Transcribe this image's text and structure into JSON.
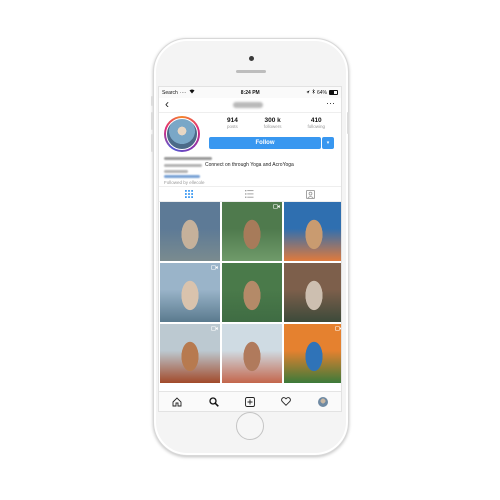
{
  "status_bar": {
    "carrier": "Search",
    "signal": "····",
    "time": "8:24 PM",
    "battery": "64%"
  },
  "nav": {
    "back_glyph": "‹",
    "more_glyph": "···"
  },
  "profile": {
    "stats": [
      {
        "num": "914",
        "label": "posts"
      },
      {
        "num": "300 k",
        "label": "followers"
      },
      {
        "num": "410",
        "label": "following"
      }
    ],
    "follow_label": "Follow",
    "dropdown_glyph": "▾",
    "bio_text": "Connect on through Yoga and AcroYoga",
    "followed_by": "Followed by ellecole"
  },
  "grid": {
    "cells": [
      {
        "colors": [
          "#5d7a96",
          "#c5b19b",
          "#7a8b8f"
        ],
        "video": false
      },
      {
        "colors": [
          "#4f7a4d",
          "#a77b5a",
          "#6f9a6a"
        ],
        "video": true
      },
      {
        "colors": [
          "#2f6fb0",
          "#c99b70",
          "#e07a3c"
        ],
        "video": false
      },
      {
        "colors": [
          "#9ab4c9",
          "#d9c3ad",
          "#5a7a8e"
        ],
        "video": true
      },
      {
        "colors": [
          "#4a7a4a",
          "#b48a68",
          "#3f6c43"
        ],
        "video": false
      },
      {
        "colors": [
          "#7d5f4b",
          "#cdbfb0",
          "#3c4a3a"
        ],
        "video": false
      },
      {
        "colors": [
          "#bcc9d1",
          "#b77a4f",
          "#a24a2b"
        ],
        "video": true
      },
      {
        "colors": [
          "#cfdbe3",
          "#b07a5c",
          "#c4664c"
        ],
        "video": false
      },
      {
        "colors": [
          "#e5812f",
          "#2f73b8",
          "#3c7a3a"
        ],
        "video": true
      }
    ]
  },
  "icons": {
    "grid_tab": "grid-icon",
    "list_tab": "list-icon",
    "tagged_tab": "tagged-icon",
    "home": "home-icon",
    "search": "search-icon",
    "add": "add-post-icon",
    "activity": "heart-icon",
    "profile": "profile-avatar"
  },
  "colors": {
    "accent": "#3897f0",
    "secondary_text": "#999999",
    "active_tab": "#3897f0"
  }
}
